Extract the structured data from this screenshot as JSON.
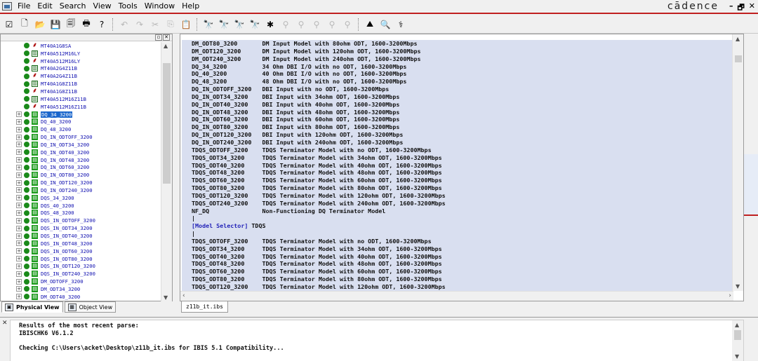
{
  "menubar": {
    "items": [
      "File",
      "Edit",
      "Search",
      "View",
      "Tools",
      "Window",
      "Help"
    ],
    "brand": "cādence",
    "window_buttons": [
      "–",
      "🗗",
      "✕"
    ]
  },
  "toolbar": {
    "groups": [
      [
        {
          "icon": "checkbox-icon",
          "glyph": "☑"
        },
        {
          "icon": "new-file-icon",
          "glyph": "🗋"
        },
        {
          "icon": "open-folder-icon",
          "glyph": "📂"
        },
        {
          "icon": "save-icon",
          "glyph": "💾"
        },
        {
          "icon": "save-all-icon",
          "glyph": "🗐"
        },
        {
          "icon": "print-icon",
          "glyph": "🖶"
        },
        {
          "icon": "help-icon",
          "glyph": "?"
        }
      ],
      [
        {
          "icon": "undo-icon",
          "glyph": "↶",
          "disabled": true
        },
        {
          "icon": "redo-icon",
          "glyph": "↷",
          "disabled": true
        },
        {
          "icon": "cut-icon",
          "glyph": "✂",
          "disabled": true
        },
        {
          "icon": "copy-icon",
          "glyph": "⎘",
          "disabled": true
        },
        {
          "icon": "paste-icon",
          "glyph": "📋",
          "disabled": true
        }
      ],
      [
        {
          "icon": "find-icon",
          "glyph": "🔭"
        },
        {
          "icon": "find-next-icon",
          "glyph": "🔭"
        },
        {
          "icon": "find-prev-icon",
          "glyph": "🔭"
        },
        {
          "icon": "replace-icon",
          "glyph": "🔭"
        },
        {
          "icon": "bookmark-icon",
          "glyph": "✱"
        },
        {
          "icon": "bookmark-next-icon",
          "glyph": "⚲",
          "disabled": true
        },
        {
          "icon": "bookmark-prev-icon",
          "glyph": "⚲",
          "disabled": true
        },
        {
          "icon": "bookmark-clear-icon",
          "glyph": "⚲",
          "disabled": true
        },
        {
          "icon": "bookmark-list-icon",
          "glyph": "⚲",
          "disabled": true
        },
        {
          "icon": "bookmark-all-icon",
          "glyph": "⚲",
          "disabled": true
        }
      ],
      [
        {
          "icon": "waveform-icon",
          "glyph": "⛰"
        },
        {
          "icon": "zoom-icon",
          "glyph": "🔍"
        },
        {
          "icon": "probe-icon",
          "glyph": "⚕"
        }
      ]
    ]
  },
  "tree": {
    "rows": [
      {
        "label": "MT40A1G8SA",
        "icon": "pin"
      },
      {
        "label": "MT40A512M16LY",
        "icon": "chip"
      },
      {
        "label": "MT40A512M16LY",
        "icon": "pin"
      },
      {
        "label": "MT40A2G4Z11B",
        "icon": "chip"
      },
      {
        "label": "MT40A2G4Z11B",
        "icon": "pin"
      },
      {
        "label": "MT40A1G8Z11B",
        "icon": "chip"
      },
      {
        "label": "MT40A1G8Z11B",
        "icon": "pin"
      },
      {
        "label": "MT40A512M16Z11B",
        "icon": "chip"
      },
      {
        "label": "MT40A512M16Z11B",
        "icon": "pin"
      },
      {
        "label": "DQ_34_3200",
        "icon": "model",
        "expandable": true,
        "selected": true
      },
      {
        "label": "DQ_40_3200",
        "icon": "model",
        "expandable": true
      },
      {
        "label": "DQ_48_3200",
        "icon": "model",
        "expandable": true
      },
      {
        "label": "DQ_IN_ODTOFF_3200",
        "icon": "model",
        "expandable": true
      },
      {
        "label": "DQ_IN_ODT34_3200",
        "icon": "model",
        "expandable": true
      },
      {
        "label": "DQ_IN_ODT40_3200",
        "icon": "model",
        "expandable": true
      },
      {
        "label": "DQ_IN_ODT48_3200",
        "icon": "model",
        "expandable": true
      },
      {
        "label": "DQ_IN_ODT60_3200",
        "icon": "model",
        "expandable": true
      },
      {
        "label": "DQ_IN_ODT80_3200",
        "icon": "model",
        "expandable": true
      },
      {
        "label": "DQ_IN_ODT120_3200",
        "icon": "model",
        "expandable": true
      },
      {
        "label": "DQ_IN_ODT240_3200",
        "icon": "model",
        "expandable": true
      },
      {
        "label": "DQS_34_3200",
        "icon": "model",
        "expandable": true
      },
      {
        "label": "DQS_40_3200",
        "icon": "model",
        "expandable": true
      },
      {
        "label": "DQS_48_3200",
        "icon": "model",
        "expandable": true
      },
      {
        "label": "DQS_IN_ODTOFF_3200",
        "icon": "model",
        "expandable": true
      },
      {
        "label": "DQS_IN_ODT34_3200",
        "icon": "model",
        "expandable": true
      },
      {
        "label": "DQS_IN_ODT40_3200",
        "icon": "model",
        "expandable": true
      },
      {
        "label": "DQS_IN_ODT48_3200",
        "icon": "model",
        "expandable": true
      },
      {
        "label": "DQS_IN_ODT60_3200",
        "icon": "model",
        "expandable": true
      },
      {
        "label": "DQS_IN_ODT80_3200",
        "icon": "model",
        "expandable": true
      },
      {
        "label": "DQS_IN_ODT120_3200",
        "icon": "model",
        "expandable": true
      },
      {
        "label": "DQS_IN_ODT240_3200",
        "icon": "model",
        "expandable": true
      },
      {
        "label": "DM_ODTOFF_3200",
        "icon": "model",
        "expandable": true
      },
      {
        "label": "DM_ODT34_3200",
        "icon": "model",
        "expandable": true
      },
      {
        "label": "DM_ODT40_3200",
        "icon": "model",
        "expandable": true
      }
    ]
  },
  "tree_tabs": [
    "Physical View",
    "Object View"
  ],
  "editor": {
    "lines": [
      {
        "text": "DM_ODT80_3200       DM Input Model with 80ohm ODT, 1600-3200Mbps"
      },
      {
        "text": "DM_ODT120_3200      DM Input Model with 120ohm ODT, 1600-3200Mbps"
      },
      {
        "text": "DM_ODT240_3200      DM Input Model with 240ohm ODT, 1600-3200Mbps"
      },
      {
        "text": "DQ_34_3200          34 Ohm DBI I/O with no ODT, 1600-3200Mbps"
      },
      {
        "text": "DQ_40_3200          40 Ohm DBI I/O with no ODT, 1600-3200Mbps"
      },
      {
        "text": "DQ_48_3200          48 Ohm DBI I/O with no ODT, 1600-3200Mbps"
      },
      {
        "text": "DQ_IN_ODTOFF_3200   DBI Input with no ODT, 1600-3200Mbps"
      },
      {
        "text": "DQ_IN_ODT34_3200    DBI Input with 34ohm ODT, 1600-3200Mbps"
      },
      {
        "text": "DQ_IN_ODT40_3200    DBI Input with 40ohm ODT, 1600-3200Mbps"
      },
      {
        "text": "DQ_IN_ODT48_3200    DBI Input with 48ohm ODT, 1600-3200Mbps"
      },
      {
        "text": "DQ_IN_ODT60_3200    DBI Input with 60ohm ODT, 1600-3200Mbps"
      },
      {
        "text": "DQ_IN_ODT80_3200    DBI Input with 80ohm ODT, 1600-3200Mbps"
      },
      {
        "text": "DQ_IN_ODT120_3200   DBI Input with 120ohm ODT, 1600-3200Mbps"
      },
      {
        "text": "DQ_IN_ODT240_3200   DBI Input with 240ohm ODT, 1600-3200Mbps"
      },
      {
        "text": "TDQS_ODTOFF_3200    TDQS Terminator Model with no ODT, 1600-3200Mbps"
      },
      {
        "text": "TDQS_ODT34_3200     TDQS Terminator Model with 34ohm ODT, 1600-3200Mbps"
      },
      {
        "text": "TDQS_ODT40_3200     TDQS Terminator Model with 40ohm ODT, 1600-3200Mbps"
      },
      {
        "text": "TDQS_ODT48_3200     TDQS Terminator Model with 48ohm ODT, 1600-3200Mbps"
      },
      {
        "text": "TDQS_ODT60_3200     TDQS Terminator Model with 60ohm ODT, 1600-3200Mbps"
      },
      {
        "text": "TDQS_ODT80_3200     TDQS Terminator Model with 80ohm ODT, 1600-3200Mbps"
      },
      {
        "text": "TDQS_ODT120_3200    TDQS Terminator Model with 120ohm ODT, 1600-3200Mbps"
      },
      {
        "text": "TDQS_ODT240_3200    TDQS Terminator Model with 240ohm ODT, 1600-3200Mbps"
      },
      {
        "text": "NF_DQ               Non-Functioning DQ Terminator Model"
      },
      {
        "text": "|"
      },
      {
        "text": "[Model Selector] TDQS",
        "keyword": "[Model Selector]"
      },
      {
        "text": "|"
      },
      {
        "text": "TDQS_ODTOFF_3200    TDQS Terminator Model with no ODT, 1600-3200Mbps"
      },
      {
        "text": "TDQS_ODT34_3200     TDQS Terminator Model with 34ohm ODT, 1600-3200Mbps"
      },
      {
        "text": "TDQS_ODT40_3200     TDQS Terminator Model with 40ohm ODT, 1600-3200Mbps"
      },
      {
        "text": "TDQS_ODT48_3200     TDQS Terminator Model with 48ohm ODT, 1600-3200Mbps"
      },
      {
        "text": "TDQS_ODT60_3200     TDQS Terminator Model with 60ohm ODT, 1600-3200Mbps"
      },
      {
        "text": "TDQS_ODT80_3200     TDQS Terminator Model with 80ohm ODT, 1600-3200Mbps"
      },
      {
        "text": "TDQS_ODT120_3200    TDQS Terminator Model with 120ohm ODT, 1600-3200Mbps"
      }
    ]
  },
  "editor_tabs": [
    "z11b_it.ibs"
  ],
  "output": {
    "lines": [
      "Results of the most recent parse:",
      "IBISCHK6 V6.1.2",
      "",
      "Checking C:\\Users\\acket\\Desktop\\z11b_it.ibs for IBIS 5.1 Compatibility..."
    ]
  },
  "colors": {
    "accent_red": "#c02020",
    "tree_label": "#1010b0",
    "selection": "#1a66cc",
    "editor_bg": "#d9dff0",
    "keyword": "#2323b8"
  }
}
